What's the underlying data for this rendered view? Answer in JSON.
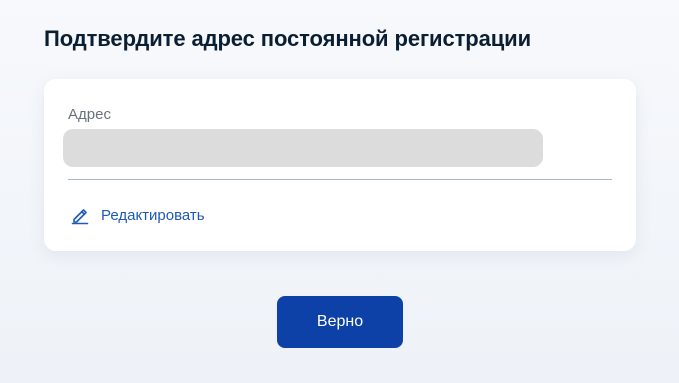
{
  "page": {
    "title": "Подтвердите адрес постоянной регистрации"
  },
  "address_card": {
    "label": "Адрес",
    "value": "",
    "edit_label": "Редактировать",
    "edit_icon": "pencil-icon"
  },
  "actions": {
    "confirm_label": "Верно"
  },
  "colors": {
    "accent": "#0d41a8",
    "link": "#1d5ab6",
    "divider": "#a3b8ce",
    "placeholder_fill": "#dcdcdc"
  }
}
